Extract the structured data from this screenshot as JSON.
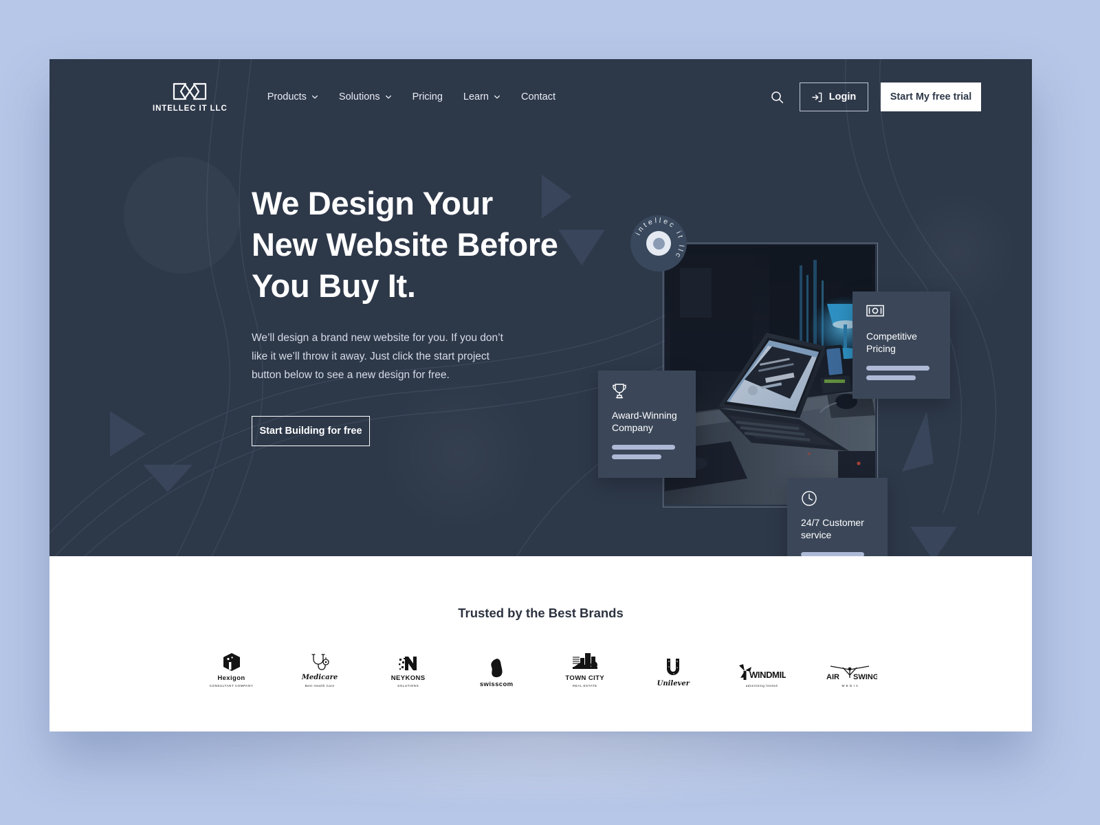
{
  "brand": {
    "name": "INTELLEC IT LLC",
    "logo_icon": "intellec-bowtie-logo",
    "badge_text": "intellec it llc"
  },
  "nav": {
    "links": [
      {
        "label": "Products",
        "has_dropdown": true
      },
      {
        "label": "Solutions",
        "has_dropdown": true
      },
      {
        "label": "Pricing",
        "has_dropdown": false
      },
      {
        "label": "Learn",
        "has_dropdown": true
      },
      {
        "label": "Contact",
        "has_dropdown": false
      }
    ],
    "search_icon": "search-icon",
    "login_label": "Login",
    "login_icon": "login-arrow-icon",
    "trial_label": "Start My free trial"
  },
  "hero": {
    "title_line1": "We Design Your",
    "title_line2": "New Website Before",
    "title_line3": "You Buy It.",
    "subtitle": "We’ll design a brand new website for you. If you don’t like it we’ll throw it away. Just click the start project button below to see a new design for free.",
    "cta_label": "Start Building for free",
    "image_alt": "laptop on desk with blue lamp at night"
  },
  "feature_cards": [
    {
      "icon": "trophy-icon",
      "title": "Award-Winning Company"
    },
    {
      "icon": "banknote-icon",
      "title": "Competitive Pricing"
    },
    {
      "icon": "clock-icon",
      "title": "24/7 Customer service"
    }
  ],
  "brands": {
    "title": "Trusted by the Best Brands",
    "logos": [
      {
        "name": "Hexigon",
        "word": "Hexigon",
        "sub": "CONSULTANT COMPANY",
        "icon": "hexigon-cube-icon"
      },
      {
        "name": "Medicare",
        "word": "Medicare",
        "sub": "Best Health Care",
        "icon": "stethoscope-icon"
      },
      {
        "name": "Neykons",
        "word": "NEYKONS",
        "sub": "SOLUTIONS",
        "icon": "neykons-n-icon"
      },
      {
        "name": "swisscom",
        "word": "swisscom",
        "sub": "",
        "icon": "swisscom-shape-icon"
      },
      {
        "name": "Town City",
        "word": "TOWN CITY",
        "sub": "REAL ESTATE",
        "icon": "city-buildings-icon"
      },
      {
        "name": "Unilever",
        "word": "Unilever",
        "sub": "",
        "icon": "unilever-u-icon"
      },
      {
        "name": "Windmill",
        "word": "WINDMILL",
        "sub": "advertising limited",
        "icon": "windmill-icon"
      },
      {
        "name": "Air Swing Media",
        "word": "AIR SWING",
        "sub": "M E D I A",
        "icon": "drone-icon"
      }
    ]
  },
  "colors": {
    "page_bg": "#b7c7e8",
    "hero_bg": "#2d3849",
    "card_bg": "#3b4759",
    "accent_bar": "#aeb9d6",
    "white": "#ffffff"
  }
}
